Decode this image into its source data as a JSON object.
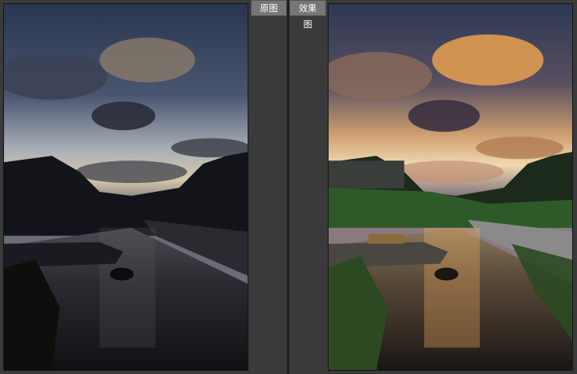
{
  "labels": {
    "before": "原图",
    "after": "效果图"
  },
  "colors": {
    "background": "#3a3a3a",
    "label_bg": "#777777",
    "sky_before_top": "#2e3b55",
    "sky_after_glow": "#f0a850"
  }
}
